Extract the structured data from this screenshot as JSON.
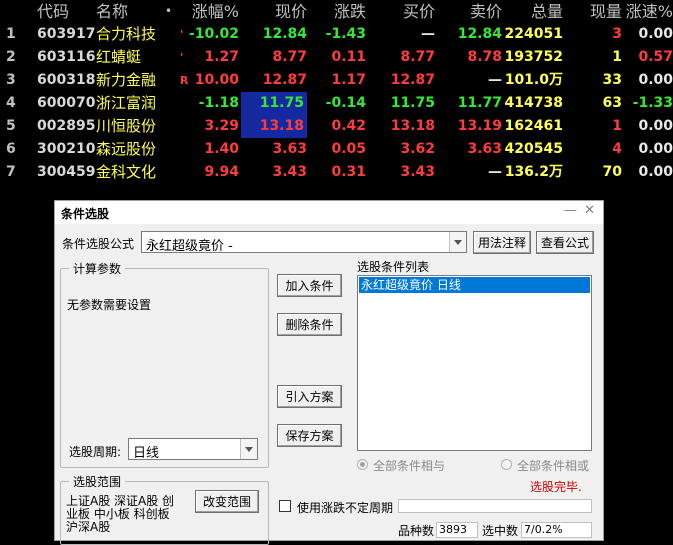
{
  "table": {
    "headers": {
      "code": "代码",
      "name": "名称",
      "dot": "•",
      "pct": "涨幅%",
      "price": "现价",
      "chg": "涨跌",
      "buy": "买价",
      "sell": "卖价",
      "vol": "总量",
      "cur": "现量",
      "spd": "涨速%"
    },
    "rows": [
      {
        "idx": "1",
        "code": "603917",
        "name": "合力科技",
        "mark": "'",
        "pct": "-10.02",
        "price": "12.84",
        "chg": "-1.43",
        "buy": "—",
        "sell": "12.84",
        "vol": "224051",
        "cur": "3",
        "spd": "0.00"
      },
      {
        "idx": "2",
        "code": "603116",
        "name": "红蜻蜓",
        "mark": "'",
        "pct": "1.27",
        "price": "8.77",
        "chg": "0.11",
        "buy": "8.77",
        "sell": "8.78",
        "vol": "193752",
        "cur": "1",
        "spd": "0.57"
      },
      {
        "idx": "3",
        "code": "600318",
        "name": "新力金融",
        "mark": "R",
        "pct": "10.00",
        "price": "12.87",
        "chg": "1.17",
        "buy": "12.87",
        "sell": "—",
        "vol": "101.0万",
        "cur": "33",
        "spd": "0.00"
      },
      {
        "idx": "4",
        "code": "600070",
        "name": "浙江富润",
        "mark": "",
        "pct": "-1.18",
        "price": "11.75",
        "chg": "-0.14",
        "buy": "11.75",
        "sell": "11.77",
        "vol": "414738",
        "cur": "63",
        "spd": "-1.33"
      },
      {
        "idx": "5",
        "code": "002895",
        "name": "川恒股份",
        "mark": "",
        "pct": "3.29",
        "price": "13.18",
        "chg": "0.42",
        "buy": "13.18",
        "sell": "13.19",
        "vol": "162461",
        "cur": "1",
        "spd": "0.00"
      },
      {
        "idx": "6",
        "code": "300210",
        "name": "森远股份",
        "mark": "",
        "pct": "1.40",
        "price": "3.63",
        "chg": "0.05",
        "buy": "3.62",
        "sell": "3.63",
        "vol": "420545",
        "cur": "4",
        "spd": "0.00"
      },
      {
        "idx": "7",
        "code": "300459",
        "name": "金科文化",
        "mark": "",
        "pct": "9.94",
        "price": "3.43",
        "chg": "0.31",
        "buy": "3.43",
        "sell": "—",
        "vol": "136.2万",
        "cur": "70",
        "spd": "0.00"
      }
    ]
  },
  "dialog": {
    "title": "条件选股",
    "formula_label": "条件选股公式",
    "formula_value": "永红超级竟价 -",
    "usage_button": "用法注释",
    "view_formula_button": "查看公式",
    "params_group": "计算参数",
    "params_text": "无参数需要设置",
    "period_label": "选股周期:",
    "period_value": "日线",
    "add_condition": "加入条件",
    "delete_condition": "删除条件",
    "import_plan": "引入方案",
    "save_plan": "保存方案",
    "list_label": "选股条件列表",
    "list_item": "永红超级竟价  日线",
    "radio_and": "全部条件相与",
    "radio_or": "全部条件相或",
    "status": "选股完毕.",
    "range_group": "选股范围",
    "range_text_1": "上证A股 深证A股 创",
    "range_text_2": "业板 中小板 科创板",
    "range_text_3": "沪深A股",
    "change_range": "改变范围",
    "use_period_label": "使用涨跌不定周期",
    "count_label": "品种数",
    "count_value": "3893",
    "selected_label": "选中数",
    "selected_value": "7/0.2%",
    "colors": {
      "accent": "#0078d7",
      "status": "#d00000",
      "up": "#ff3c3c",
      "down": "#34e834"
    }
  }
}
